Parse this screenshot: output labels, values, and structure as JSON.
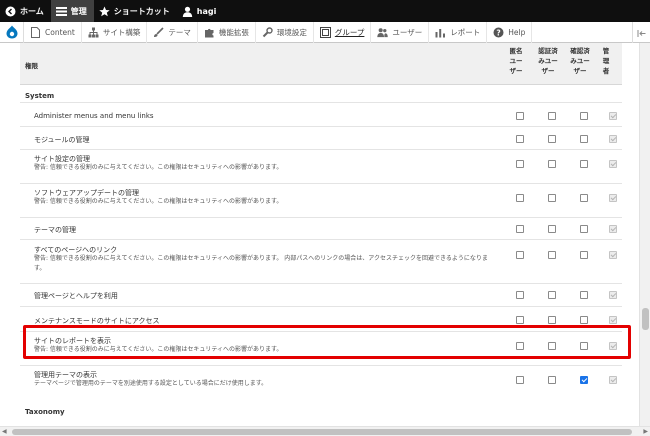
{
  "toolbar": {
    "home_label": "ホーム",
    "manage_label": "管理",
    "shortcuts_label": "ショートカット",
    "user_label": "hagi"
  },
  "tray": {
    "items": [
      {
        "label": "Content",
        "icon": "file-icon"
      },
      {
        "label": "サイト構築",
        "icon": "sitemap-icon"
      },
      {
        "label": "テーマ",
        "icon": "brush-icon"
      },
      {
        "label": "機能拡張",
        "icon": "puzzle-icon"
      },
      {
        "label": "環境設定",
        "icon": "wrench-icon"
      },
      {
        "label": "グループ",
        "icon": "group-icon"
      },
      {
        "label": "ユーザー",
        "icon": "people-icon"
      },
      {
        "label": "レポート",
        "icon": "bar-chart-icon"
      },
      {
        "label": "Help",
        "icon": "help-icon"
      }
    ],
    "active_index": 5
  },
  "table": {
    "permission_header": "権限",
    "roles": [
      {
        "line1": "匿名",
        "line2": "ユー",
        "line3": "ザー"
      },
      {
        "line1": "認証済",
        "line2": "みユー",
        "line3": "ザー"
      },
      {
        "line1": "確認済",
        "line2": "みユー",
        "line3": "ザー"
      },
      {
        "line1": "管",
        "line2": "理",
        "line3": "者"
      }
    ]
  },
  "sections": {
    "system": "System",
    "taxonomy": "Taxonomy"
  },
  "rows": [
    {
      "title": "Administer menus and menu links",
      "desc": "",
      "checks": [
        false,
        false,
        false,
        "disabled"
      ]
    },
    {
      "title": "モジュールの管理",
      "desc": "",
      "checks": [
        false,
        false,
        false,
        "disabled"
      ]
    },
    {
      "title": "サイト設定の管理",
      "desc": "警告: 信頼できる役割のみに与えてください。この権限はセキュリティへの影響があります。",
      "checks": [
        false,
        false,
        false,
        "disabled"
      ]
    },
    {
      "title": "ソフトウェアアップデートの管理",
      "desc": "警告: 信頼できる役割のみに与えてください。この権限はセキュリティへの影響があります。",
      "checks": [
        false,
        false,
        false,
        "disabled"
      ]
    },
    {
      "title": "テーマの管理",
      "desc": "",
      "checks": [
        false,
        false,
        false,
        "disabled"
      ]
    },
    {
      "title": "すべてのページへのリンク",
      "desc": "警告: 信頼できる役割のみに与えてください。この権限はセキュリティへの影響があります。 内部パスへのリンクの場合は、アクセスチェックを回避できるようになります。",
      "checks": [
        false,
        false,
        false,
        "disabled"
      ]
    },
    {
      "title": "管理ページとヘルプを利用",
      "desc": "",
      "checks": [
        false,
        false,
        false,
        "disabled"
      ]
    },
    {
      "title": "メンテナンスモードのサイトにアクセス",
      "desc": "",
      "checks": [
        false,
        false,
        false,
        "disabled"
      ]
    },
    {
      "title": "サイトのレポートを表示",
      "desc": "警告: 信頼できる役割のみに与えてください。この権限はセキュリティへの影響があります。",
      "checks": [
        false,
        false,
        false,
        "disabled"
      ]
    },
    {
      "title": "管理用テーマの表示",
      "desc": "テーマページで管理用のテーマを別途使用する設定としている場合にだけ使用します。",
      "checks": [
        false,
        false,
        true,
        "disabled"
      ]
    }
  ],
  "colors": {
    "toolbar_bg": "#0f0f0f",
    "highlight": "#e30000",
    "checked": "#1a73e8"
  }
}
